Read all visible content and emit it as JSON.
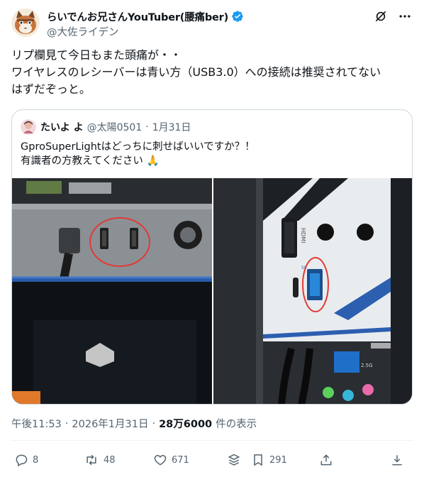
{
  "author": {
    "display_name": "らいでんお兄さんYouTuber(腰痛ber)",
    "handle": "@大佐ライデン"
  },
  "header_icons": [
    "grok-icon",
    "more-icon"
  ],
  "post_text": "リプ欄見て今日もまた頭痛が・・\nワイヤレスのレシーバーは青い方（USB3.0）への接続は推奨されてない\nはずだぞっと。",
  "quoted": {
    "display_name": "たいよ よ",
    "handle": "@太陽0501",
    "separator": "·",
    "date": "1月31日",
    "text": "GproSuperLightはどっちに刺せばいいですか？！\n有識者の方教えてください 🙏",
    "images": [
      {
        "name": "pc-front-usb-ports-photo",
        "description_hidden": true
      },
      {
        "name": "motherboard-rear-io-photo",
        "description_hidden": true
      }
    ],
    "image_labels": {
      "hdmi": "HDMI",
      "ss": "SS",
      "lan": "2.5G"
    }
  },
  "meta": {
    "time": "午後11:53",
    "sep1": "·",
    "date": "2026年1月31日",
    "sep2": "·",
    "views": "28万6000",
    "views_label": "件の表示"
  },
  "actions": {
    "replies": "8",
    "reposts": "48",
    "likes": "671",
    "bookmarks": "291"
  },
  "colors": {
    "text": "#0f1419",
    "secondary": "#536471",
    "border": "#cfd9de",
    "verified": "#1d9bf0"
  }
}
